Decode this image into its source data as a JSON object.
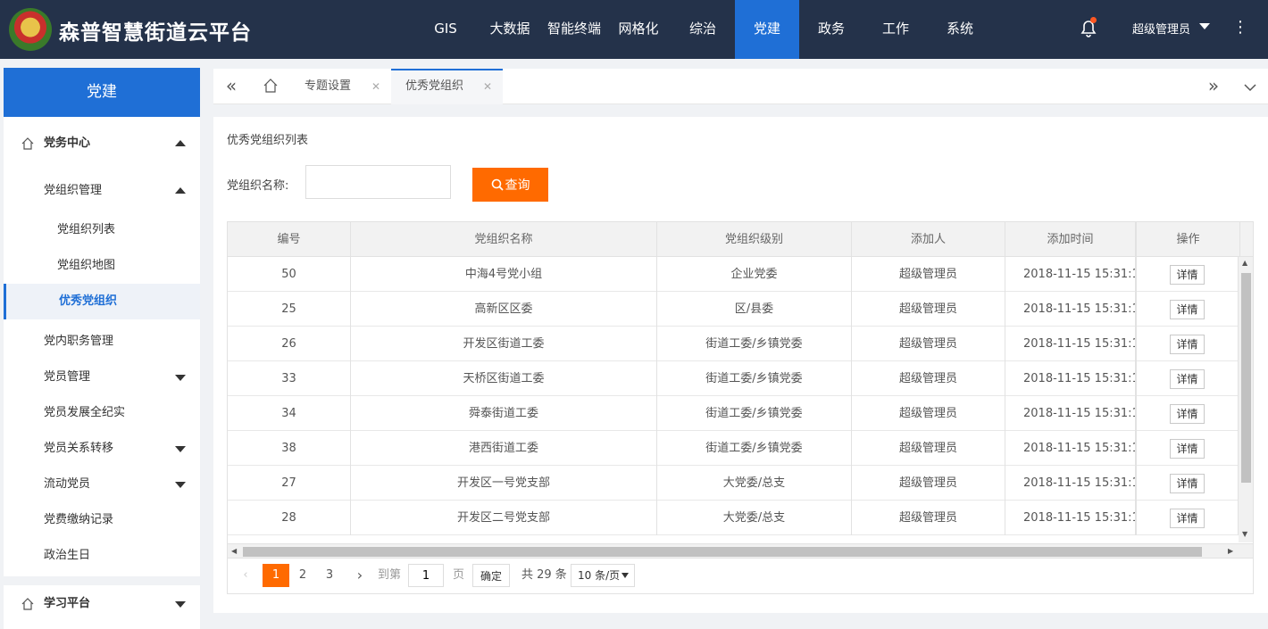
{
  "app": {
    "title": "森普智慧街道云平台"
  },
  "nav": [
    {
      "label": "GIS"
    },
    {
      "label": "大数据"
    },
    {
      "label": "智能终端"
    },
    {
      "label": "网格化"
    },
    {
      "label": "综治"
    },
    {
      "label": "党建"
    },
    {
      "label": "政务"
    },
    {
      "label": "工作"
    },
    {
      "label": "系统"
    }
  ],
  "nav_active": "党建",
  "user": {
    "name": "超级管理员"
  },
  "sidebar": {
    "title": "党建",
    "items": [
      {
        "label": "党务中心"
      },
      {
        "label": "党组织管理"
      },
      {
        "label": "党组织列表"
      },
      {
        "label": "党组织地图"
      },
      {
        "label": "优秀党组织"
      },
      {
        "label": "党内职务管理"
      },
      {
        "label": "党员管理"
      },
      {
        "label": "党员发展全纪实"
      },
      {
        "label": "党员关系转移"
      },
      {
        "label": "流动党员"
      },
      {
        "label": "党费缴纳记录"
      },
      {
        "label": "政治生日"
      },
      {
        "label": "学习平台"
      }
    ]
  },
  "tabs": [
    {
      "label": "专题设置"
    },
    {
      "label": "优秀党组织"
    }
  ],
  "main": {
    "card_title": "优秀党组织列表",
    "search_label": "党组织名称:",
    "search_value": "",
    "search_button": "查询"
  },
  "table": {
    "headers": [
      "编号",
      "党组织名称",
      "党组织级别",
      "添加人",
      "添加时间",
      "操作"
    ],
    "detail_label": "详情",
    "rows": [
      [
        "50",
        "中海4号党小组",
        "企业党委",
        "超级管理员",
        "2018-11-15 15:31:1"
      ],
      [
        "25",
        "高新区区委",
        "区/县委",
        "超级管理员",
        "2018-11-15 15:31:1"
      ],
      [
        "26",
        "开发区街道工委",
        "街道工委/乡镇党委",
        "超级管理员",
        "2018-11-15 15:31:1"
      ],
      [
        "33",
        "天桥区街道工委",
        "街道工委/乡镇党委",
        "超级管理员",
        "2018-11-15 15:31:1"
      ],
      [
        "34",
        "舜泰街道工委",
        "街道工委/乡镇党委",
        "超级管理员",
        "2018-11-15 15:31:1"
      ],
      [
        "38",
        "港西街道工委",
        "街道工委/乡镇党委",
        "超级管理员",
        "2018-11-15 15:31:1"
      ],
      [
        "27",
        "开发区一号党支部",
        "大党委/总支",
        "超级管理员",
        "2018-11-15 15:31:1"
      ],
      [
        "28",
        "开发区二号党支部",
        "大党委/总支",
        "超级管理员",
        "2018-11-15 15:31:1"
      ]
    ]
  },
  "pagination": {
    "pages": [
      "1",
      "2",
      "3"
    ],
    "current": "1",
    "goto_label": "到第",
    "goto_value": "1",
    "page_unit": "页",
    "confirm": "确定",
    "total": "共 29 条",
    "page_size": "10 条/页"
  },
  "colors": {
    "topbar": "#24324a",
    "accent": "#1f6fd6",
    "button": "#ff6a00"
  }
}
